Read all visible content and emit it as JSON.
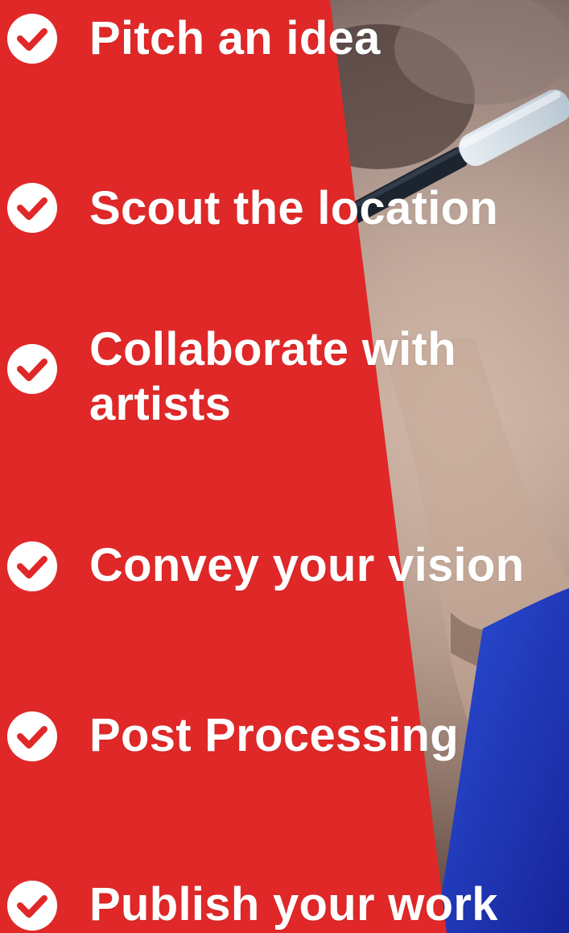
{
  "colors": {
    "panel_red": "#e02828",
    "text": "#ffffff",
    "check_mark": "#e02828"
  },
  "checklist": {
    "icon": "check-circle-icon",
    "items": [
      {
        "label": "Pitch an idea"
      },
      {
        "label": "Scout the location"
      },
      {
        "label": "Collaborate with artists"
      },
      {
        "label": "Convey your vision"
      },
      {
        "label": "Post Processing"
      },
      {
        "label": "Publish your work"
      }
    ]
  }
}
